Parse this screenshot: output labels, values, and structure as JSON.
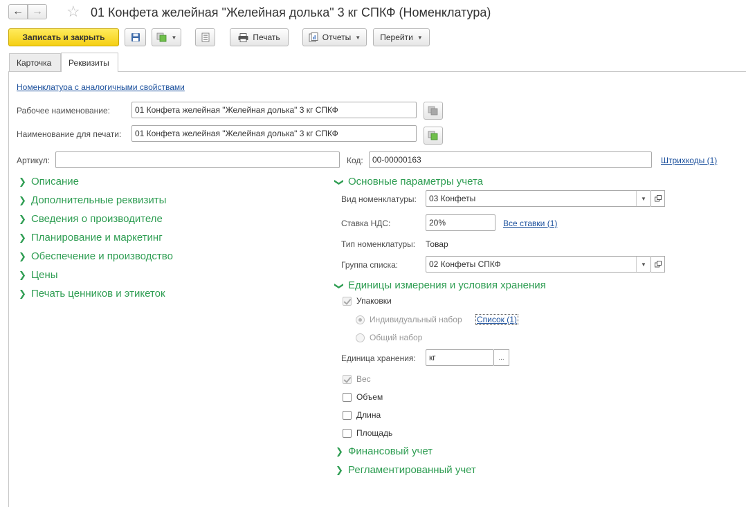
{
  "window": {
    "title": "01 Конфета желейная \"Желейная долька\" 3 кг СПКФ (Номенклатура)"
  },
  "toolbar": {
    "save_close_label": "Записать и закрыть",
    "print_label": "Печать",
    "reports_label": "Отчеты",
    "goto_label": "Перейти"
  },
  "tabs": [
    {
      "label": "Карточка",
      "active": false
    },
    {
      "label": "Реквизиты",
      "active": true
    }
  ],
  "similar_link": "Номенклатура с аналогичными свойствами",
  "fields": {
    "work_name_label": "Рабочее наименование:",
    "work_name_value": "01 Конфета желейная \"Желейная долька\" 3 кг СПКФ",
    "print_name_label": "Наименование для печати:",
    "print_name_value": "01 Конфета желейная \"Желейная долька\" 3 кг СПКФ",
    "article_label": "Артикул:",
    "article_value": "",
    "code_label": "Код:",
    "code_value": "00-00000163",
    "barcodes_link": "Штрихкоды (1)"
  },
  "left_groups": [
    "Описание",
    "Дополнительные реквизиты",
    "Сведения о производителе",
    "Планирование и маркетинг",
    "Обеспечение и производство",
    "Цены",
    "Печать ценников и этикеток"
  ],
  "accounting": {
    "title": "Основные параметры учета",
    "kind_label": "Вид номенклатуры:",
    "kind_value": "03 Конфеты",
    "vat_label": "Ставка НДС:",
    "vat_value": "20%",
    "all_rates_link": "Все ставки (1)",
    "type_label": "Тип номенклатуры:",
    "type_value": "Товар",
    "list_group_label": "Группа списка:",
    "list_group_value": "02 Конфеты СПКФ"
  },
  "units": {
    "title": "Единицы измерения и условия хранения",
    "packages_label": "Упаковки",
    "packages_checked": true,
    "individual_label": "Индивидуальный набор",
    "list_link": "Список (1)",
    "common_label": "Общий набор",
    "storage_unit_label": "Единица хранения:",
    "storage_unit_value": "кг",
    "storage_unit_btn": "...",
    "weight_label": "Вес",
    "weight_checked": true,
    "volume_label": "Объем",
    "volume_checked": false,
    "length_label": "Длина",
    "length_checked": false,
    "area_label": "Площадь",
    "area_checked": false
  },
  "bottom_groups": [
    "Финансовый учет",
    "Регламентированный учет"
  ],
  "colors": {
    "group_green": "#2e9d52",
    "link_blue": "#1a4f9c",
    "primary_yellow": "#f5cf13"
  }
}
